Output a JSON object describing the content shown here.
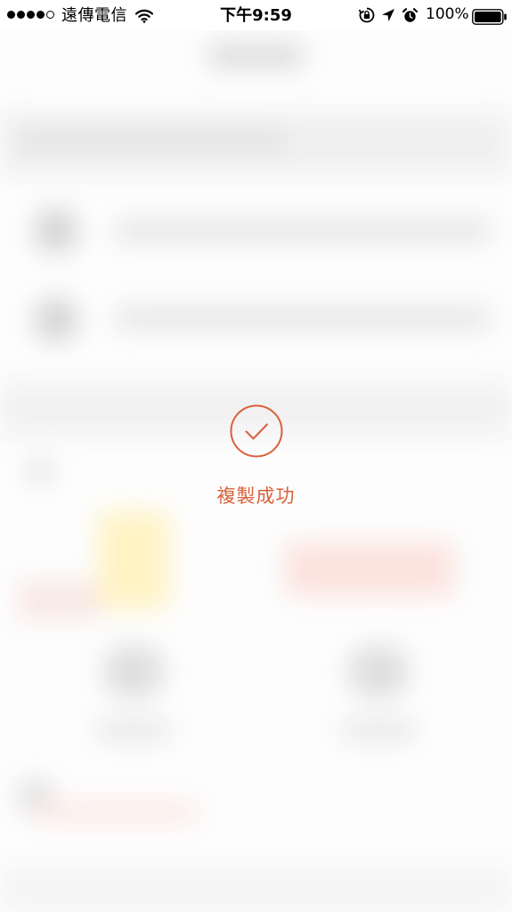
{
  "status_bar": {
    "signal_bars_filled": 4,
    "signal_bars_total": 5,
    "carrier": "遠傳電信",
    "time": "下午9:59",
    "battery_percent": "100%",
    "icons": [
      "wifi-icon",
      "orientation-lock-icon",
      "location-arrow-icon",
      "alarm-clock-icon",
      "battery-icon"
    ]
  },
  "toast": {
    "icon": "checkmark-circle-icon",
    "message": "複製成功"
  },
  "colors": {
    "accent": "#d9603b",
    "background": "#fdfdfd"
  }
}
